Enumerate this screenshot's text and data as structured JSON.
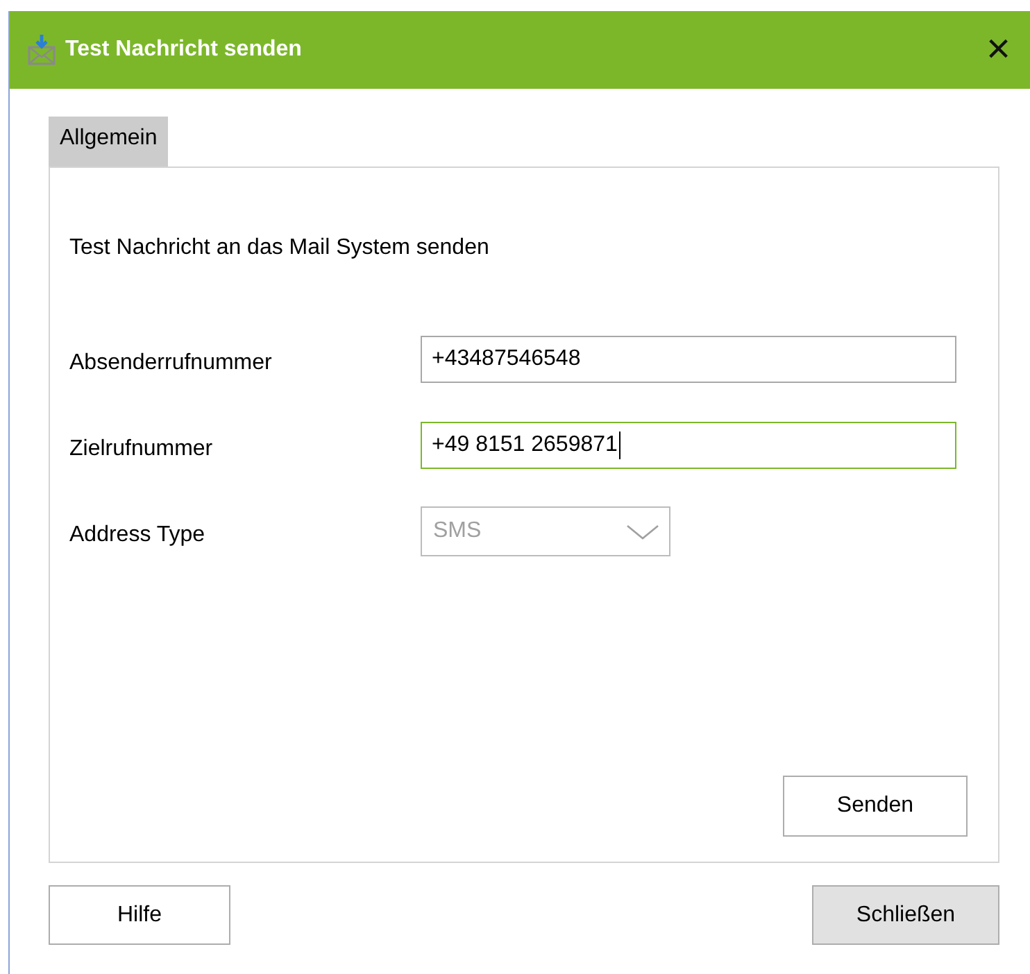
{
  "window": {
    "title": "Test Nachricht senden",
    "close": "×"
  },
  "tabs": [
    {
      "label": "Allgemein",
      "selected": true
    }
  ],
  "description": "Test Nachricht an das Mail System senden",
  "fields": [
    {
      "kind": "text",
      "label": "Absenderrufnummer",
      "value": "+43487546548",
      "focused": false,
      "disabled": false
    },
    {
      "kind": "text",
      "label": "Zielrufnummer",
      "value": "+49 8151 2659871",
      "focused": true,
      "disabled": false
    },
    {
      "kind": "dropdown",
      "label": "Address Type",
      "value": "SMS",
      "focused": false,
      "disabled": true
    }
  ],
  "panel_button": {
    "label": "Senden",
    "default": false
  },
  "footer_buttons": [
    {
      "label": "Hilfe",
      "default": false
    },
    {
      "label": "Schließen",
      "default": true
    }
  ]
}
